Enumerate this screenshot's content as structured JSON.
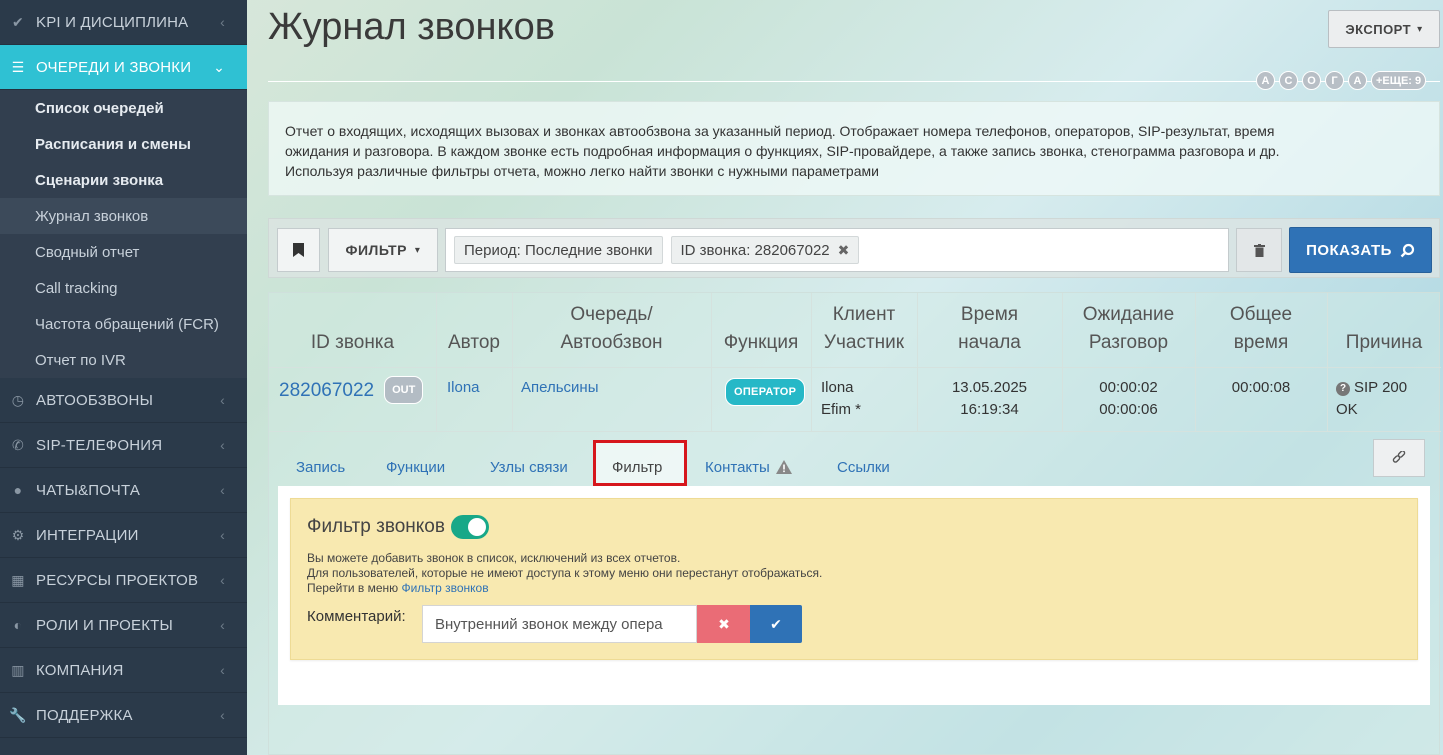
{
  "sidebar": {
    "items_top": [
      {
        "label": "KPI И ДИСЦИПЛИНА",
        "icon": "check-icon"
      },
      {
        "label": "ОЧЕРЕДИ И ЗВОНКИ",
        "icon": "list-icon"
      }
    ],
    "sub": [
      {
        "label": "Список очередей"
      },
      {
        "label": "Расписания и смены"
      },
      {
        "label": "Сценарии звонка"
      },
      {
        "label": "Журнал звонков"
      },
      {
        "label": "Сводный отчет"
      },
      {
        "label": "Call tracking"
      },
      {
        "label": "Частота обращений (FCR)"
      },
      {
        "label": "Отчет по IVR"
      }
    ],
    "items_bottom": [
      {
        "label": "АВТООБЗВОНЫ",
        "icon": "clock-icon"
      },
      {
        "label": "SIP-ТЕЛЕФОНИЯ",
        "icon": "phone-icon"
      },
      {
        "label": "ЧАТЫ&ПОЧТА",
        "icon": "chat-icon"
      },
      {
        "label": "ИНТЕГРАЦИИ",
        "icon": "gears-icon"
      },
      {
        "label": "РЕСУРСЫ ПРОЕКТОВ",
        "icon": "grid-icon"
      },
      {
        "label": "РОЛИ И ПРОЕКТЫ",
        "icon": "toggle-icon"
      },
      {
        "label": "КОМПАНИЯ",
        "icon": "bar-chart-icon"
      },
      {
        "label": "ПОДДЕРЖКА",
        "icon": "wrench-icon"
      }
    ]
  },
  "header": {
    "title": "Журнал звонков",
    "export_label": "ЭКСПОРТ",
    "letters": [
      "А",
      "С",
      "О",
      "Г",
      "А"
    ],
    "more_label": "+ЕЩЕ: 9"
  },
  "description": {
    "line1": "Отчет о входящих, исходящих вызовах и звонках автообзвона за указанный период. Отображает номера телефонов, операторов, SIP-результат, время",
    "line2": "ожидания и разговора. В каждом звонке есть подробная информация о функциях, SIP-провайдере, а также запись звонка, стенограмма разговора и др.",
    "line3": "Используя различные фильтры отчета, можно легко найти звонки с нужными параметрами"
  },
  "filterbar": {
    "filter_label": "ФИЛЬТР",
    "tags": [
      "Период: Последние звонки",
      "ID звонка: 282067022"
    ],
    "show_label": "ПОКАЗАТЬ"
  },
  "table": {
    "headers": {
      "id": "ID звонка",
      "author": "Автор",
      "queue1": "Очередь/",
      "queue2": "Автообзвон",
      "function": "Функция",
      "client1": "Клиент",
      "client2": "Участник",
      "start1": "Время",
      "start2": "начала",
      "wait1": "Ожидание",
      "wait2": "Разговор",
      "total1": "Общее",
      "total2": "время",
      "reason": "Причина"
    },
    "row": {
      "id": "282067022",
      "direction": "OUT",
      "author": "Ilona",
      "queue": "Апельсины",
      "function": "ОПЕРАТОР",
      "client": "Ilona",
      "participant": "Efim *",
      "date": "13.05.2025",
      "time": "16:19:34",
      "wait": "00:00:02",
      "talk": "00:00:06",
      "total": "00:00:08",
      "reason1": "SIP 200",
      "reason2": "OK"
    }
  },
  "tabs": [
    "Запись",
    "Функции",
    "Узлы связи",
    "Фильтр",
    "Контакты",
    "Ссылки"
  ],
  "filter_panel": {
    "title": "Фильтр звонков",
    "text1": "Вы можете добавить звонок в список, исключений из всех отчетов.",
    "text2": "Для пользователей, которые не имеют доступа к этому меню они перестанут отображаться.",
    "text3_prefix": "Перейти в меню ",
    "text3_link": "Фильтр звонков",
    "comment_label": "Комментарий:",
    "comment_value": "Внутренний звонок между опера"
  }
}
